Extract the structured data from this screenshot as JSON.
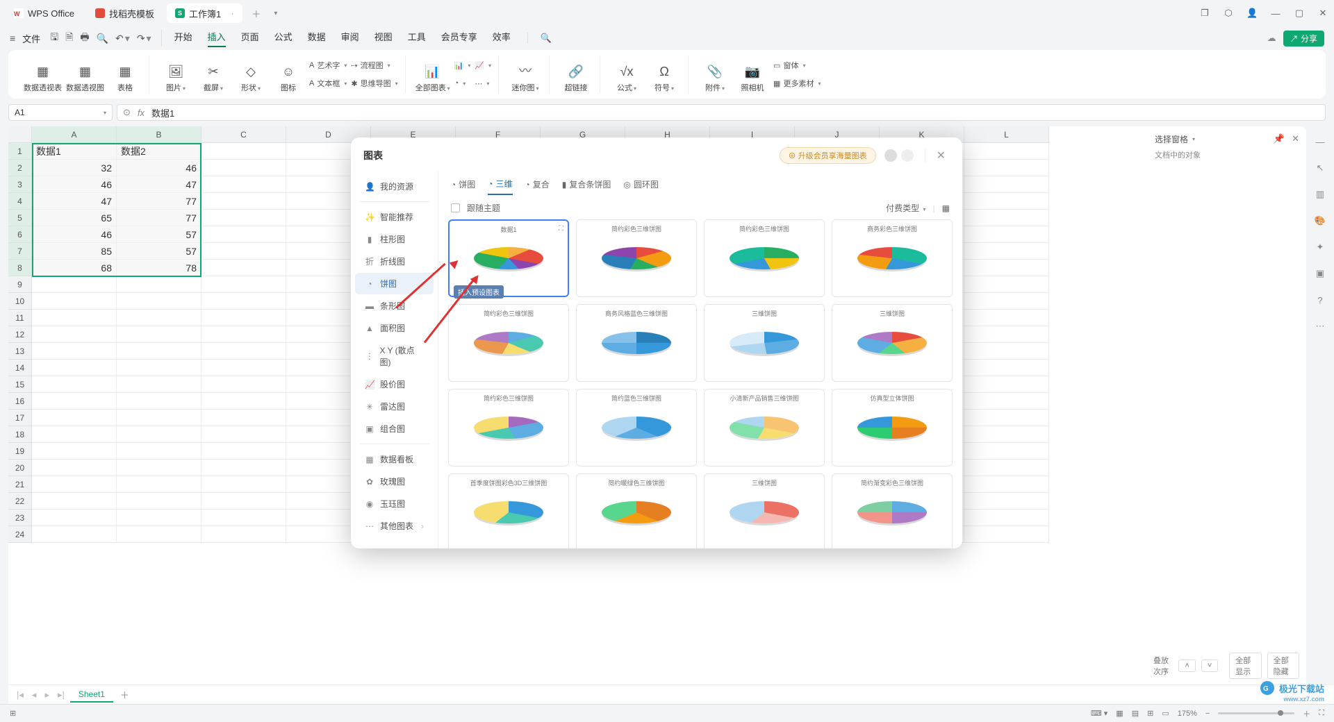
{
  "titlebar": {
    "tabs": [
      {
        "label": "WPS Office"
      },
      {
        "label": "找稻壳模板"
      },
      {
        "label": "工作簿1"
      }
    ]
  },
  "menubar": {
    "file": "文件",
    "tabs": [
      "开始",
      "插入",
      "页面",
      "公式",
      "数据",
      "审阅",
      "视图",
      "工具",
      "会员专享",
      "效率"
    ],
    "active_tab": "插入",
    "share": "分享"
  },
  "ribbon": {
    "g1": {
      "a": "数据透视表",
      "b": "数据透视图",
      "c": "表格"
    },
    "g2": {
      "a": "图片",
      "b": "截屏",
      "c": "形状",
      "d": "图标"
    },
    "g2b": {
      "a": "艺术字",
      "b": "文本框",
      "c": "流程图",
      "d": "思维导图"
    },
    "g3": {
      "a": "全部图表"
    },
    "g4": {
      "a": "迷你图"
    },
    "g5": {
      "a": "超链接"
    },
    "g6": {
      "a": "公式",
      "b": "符号"
    },
    "g7": {
      "a": "附件",
      "b": "照相机",
      "c": "更多素材",
      "d": "窗体"
    }
  },
  "formula": {
    "cell": "A1",
    "fx": "数据1"
  },
  "sheet": {
    "cols": [
      "A",
      "B",
      "C",
      "D",
      "E",
      "F",
      "G",
      "H",
      "I",
      "J",
      "K",
      "L"
    ],
    "rows": 24,
    "data": {
      "A1": "数据1",
      "B1": "数据2",
      "A2": "32",
      "B2": "46",
      "A3": "46",
      "B3": "47",
      "A4": "47",
      "B4": "77",
      "A5": "65",
      "B5": "77",
      "A6": "46",
      "B6": "57",
      "A7": "85",
      "B7": "57",
      "A8": "68",
      "B8": "78"
    }
  },
  "chart_data": {
    "type": "table",
    "columns": [
      "数据1",
      "数据2"
    ],
    "rows": [
      [
        32,
        46
      ],
      [
        46,
        47
      ],
      [
        47,
        77
      ],
      [
        65,
        77
      ],
      [
        46,
        57
      ],
      [
        85,
        57
      ],
      [
        68,
        78
      ]
    ]
  },
  "dialog": {
    "title": "图表",
    "promo": "升级会员享海量图表",
    "side": [
      "我的资源",
      "智能推荐",
      "柱形图",
      "折线图",
      "饼图",
      "条形图",
      "面积图",
      "X Y (散点图)",
      "股价图",
      "雷达图",
      "组合图",
      "数据看板",
      "玫瑰图",
      "玉珏图",
      "其他图表"
    ],
    "side_active": "饼图",
    "sub_tabs": [
      "饼图",
      "三维",
      "复合",
      "复合条饼图",
      "圆环图"
    ],
    "sub_active": "三维",
    "follow_theme": "跟随主题",
    "pay_filter": "付费类型",
    "tooltip": "插入预设图表",
    "thumbs": [
      "数据1",
      "简约彩色三维饼图",
      "简约彩色三维饼图",
      "商务彩色三维饼图",
      "简约彩色三维饼图",
      "商务风格蓝色三维饼图",
      "三维饼图",
      "三维饼图",
      "简约彩色三维饼图",
      "简约蓝色三维饼图",
      "小清新产品销售三维饼图",
      "仿真型立体饼图",
      "首季度饼图彩色3D三维饼图",
      "简约暖绿色三维饼图",
      "三维饼图",
      "简约渐变彩色三维饼图"
    ]
  },
  "side_panel": {
    "title": "选择窗格",
    "sub": "文档中的对象",
    "stack": "叠放次序",
    "show_all": "全部显示",
    "hide_all": "全部隐藏"
  },
  "sheet_tabs": {
    "active": "Sheet1"
  },
  "statusbar": {
    "zoom": "175%"
  },
  "watermark": {
    "name": "极光下载站",
    "url": "www.xz7.com"
  }
}
